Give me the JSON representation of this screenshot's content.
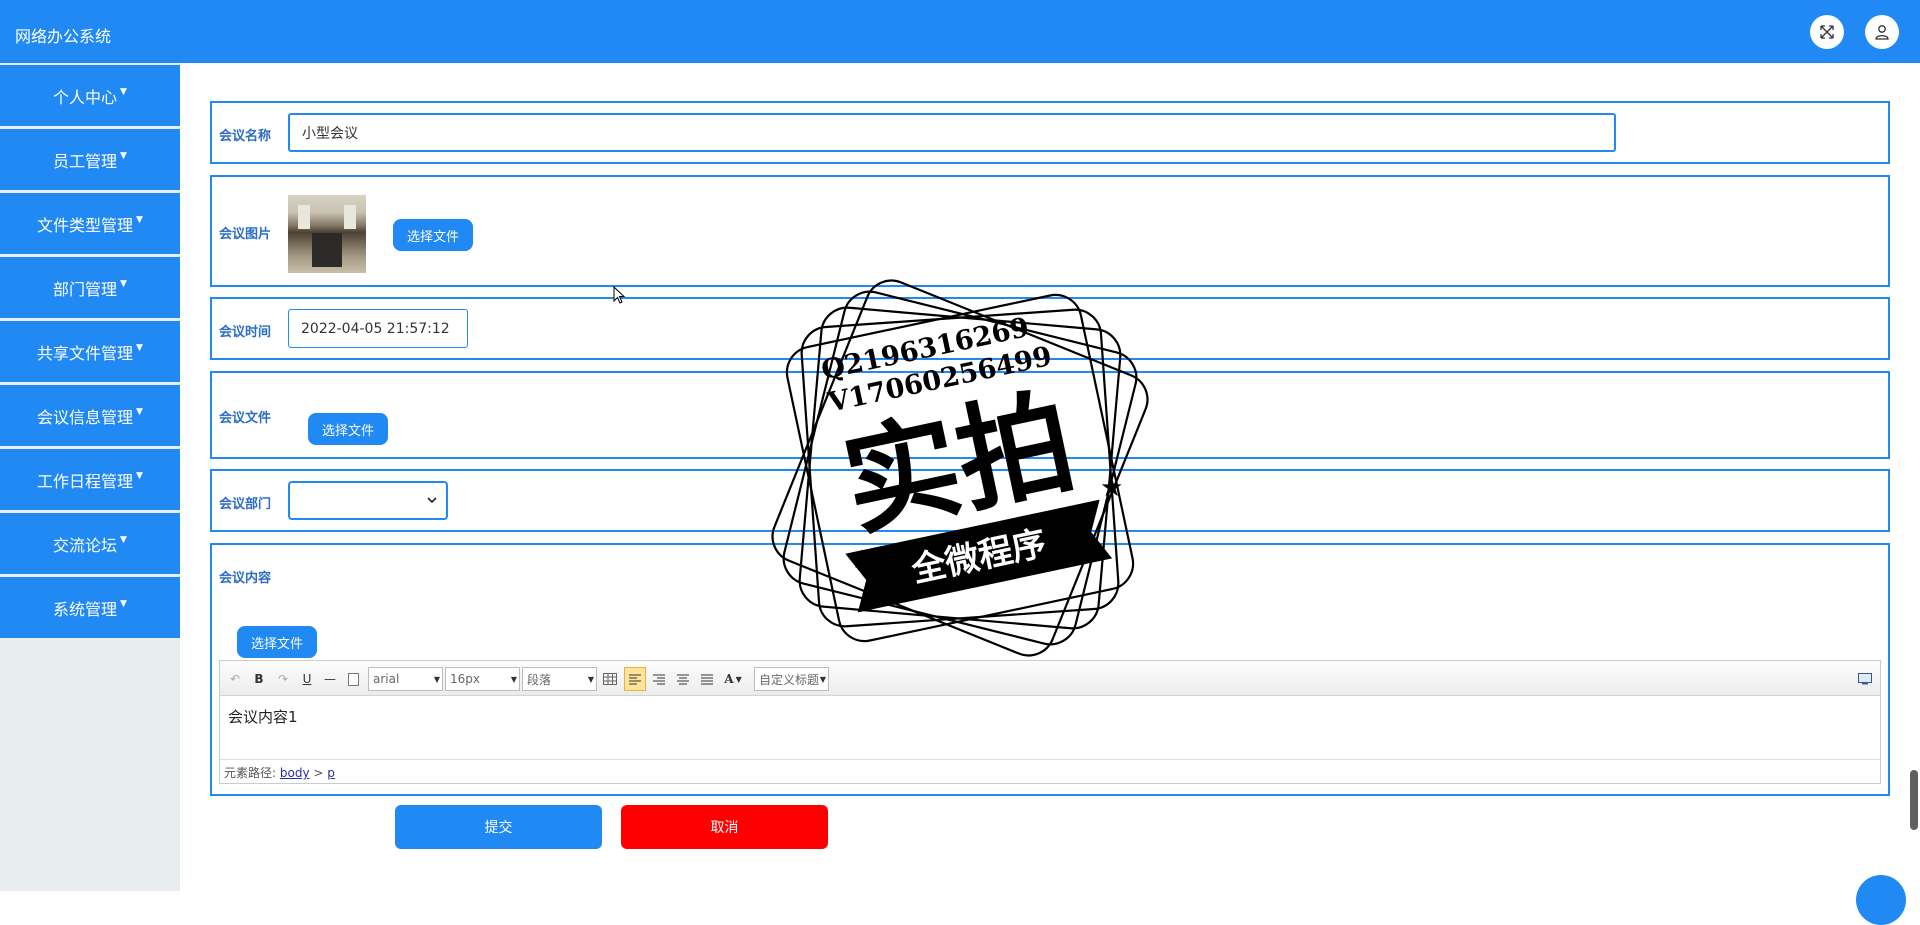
{
  "app": {
    "title": "网络办公系统"
  },
  "header": {
    "fullscreen_icon": "expand-icon",
    "user_icon": "user-icon"
  },
  "sidebar": {
    "items": [
      {
        "label": "个人中心"
      },
      {
        "label": "员工管理"
      },
      {
        "label": "文件类型管理"
      },
      {
        "label": "部门管理"
      },
      {
        "label": "共享文件管理"
      },
      {
        "label": "会议信息管理"
      },
      {
        "label": "工作日程管理"
      },
      {
        "label": "交流论坛"
      },
      {
        "label": "系统管理"
      }
    ],
    "caret": "▼"
  },
  "form": {
    "name": {
      "label": "会议名称",
      "value": "小型会议"
    },
    "image": {
      "label": "会议图片",
      "button": "选择文件"
    },
    "time": {
      "label": "会议时间",
      "value": "2022-04-05 21:57:12"
    },
    "file": {
      "label": "会议文件",
      "button": "选择文件"
    },
    "department": {
      "label": "会议部门",
      "value": ""
    },
    "content": {
      "label": "会议内容",
      "button": "选择文件",
      "toolbar": {
        "font_family": "arial",
        "font_size": "16px",
        "paragraph": "段落",
        "custom_heading": "自定义标题",
        "font_color_glyph": "A"
      },
      "text": "会议内容1",
      "path_label": "元素路径:",
      "path_body": "body",
      "path_sep": ">",
      "path_p": "p"
    }
  },
  "actions": {
    "submit": "提交",
    "cancel": "取消"
  },
  "colors": {
    "primary": "#2089f3",
    "danger": "#ff0000",
    "sidebar_bg": "#e8eef0"
  },
  "watermark": {
    "line1": "Q2196316269",
    "line2": "V17060256499",
    "main": "实拍",
    "banner": "全微程序"
  }
}
